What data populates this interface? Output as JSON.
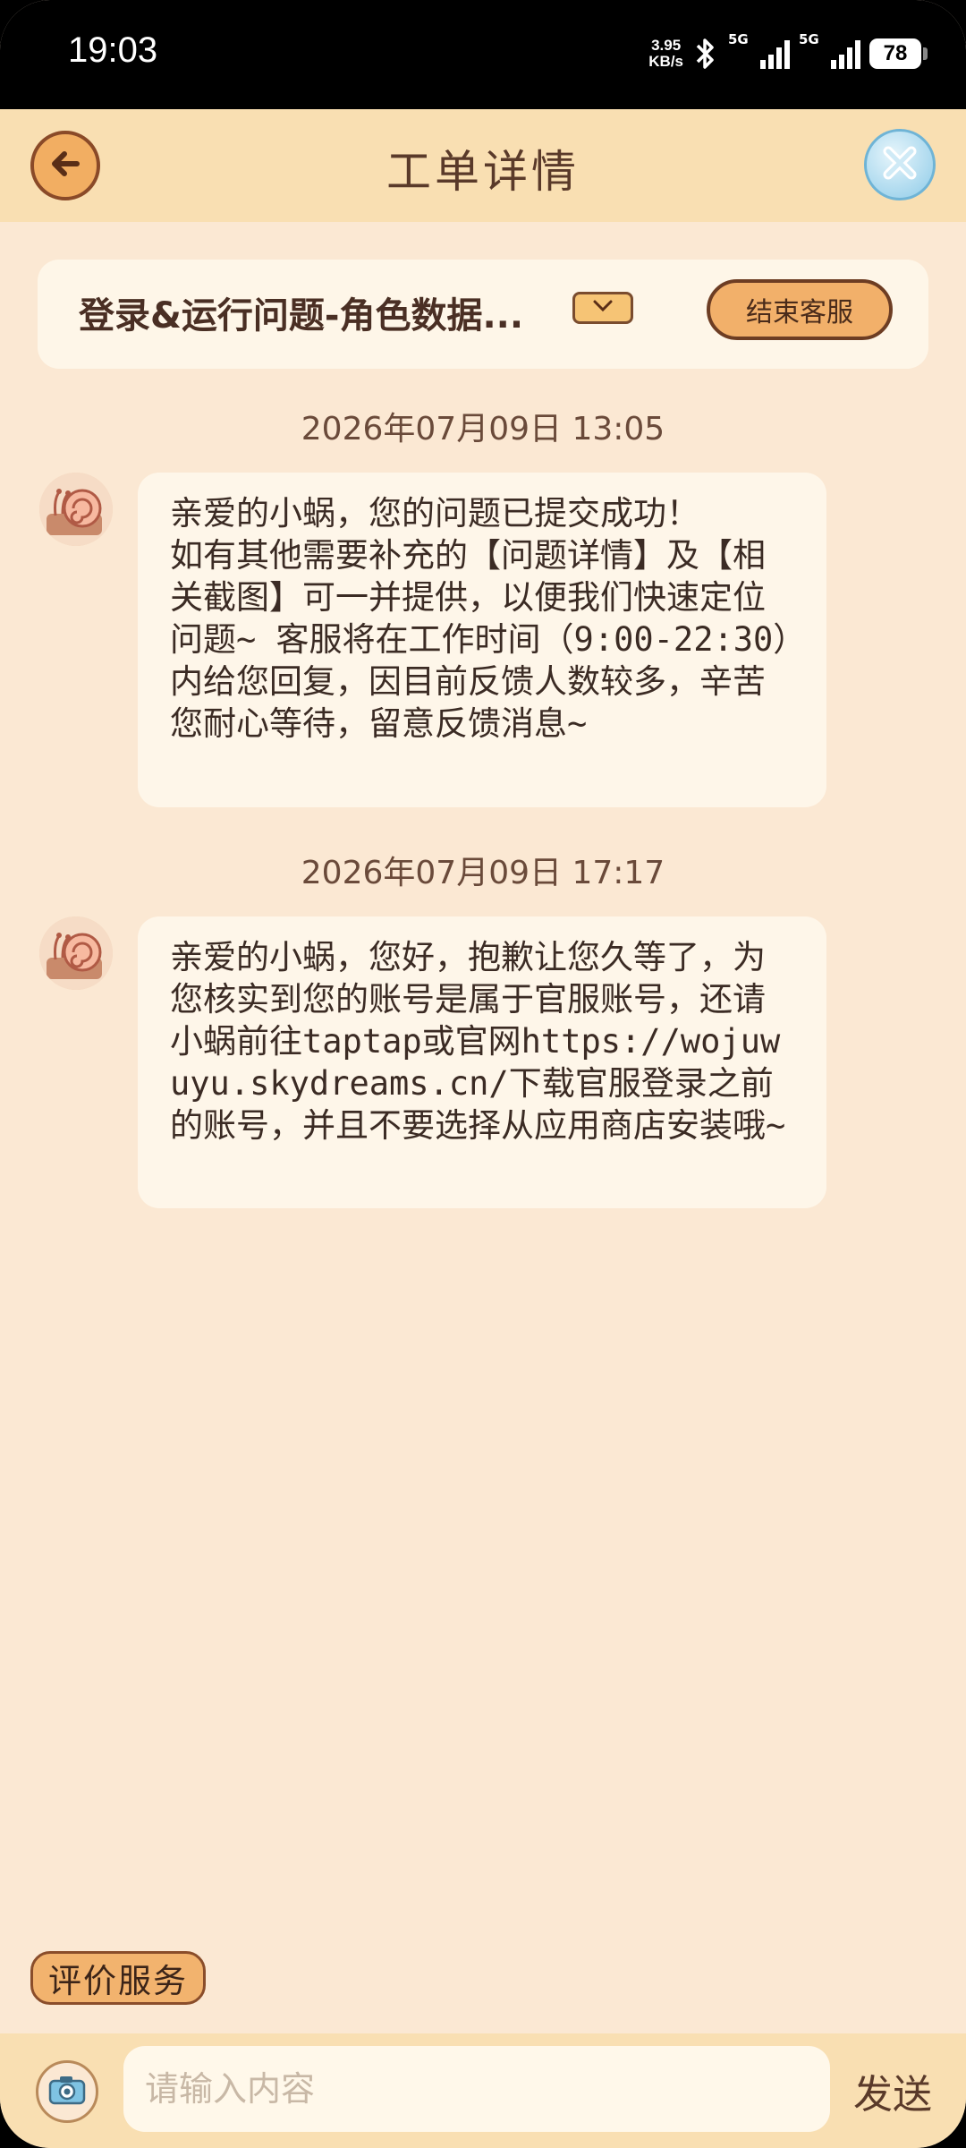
{
  "status_bar": {
    "time": "19:03",
    "net_speed_value": "3.95",
    "net_speed_unit": "KB/s",
    "signal_1_label": "5G",
    "signal_2_label": "5G",
    "battery": "78"
  },
  "header": {
    "title": "工单详情",
    "back_icon": "back-arrow-icon",
    "close_icon": "close-x-icon"
  },
  "ticket": {
    "title": "登录&运行问题-角色数据...",
    "dropdown_icon": "chevron-down-icon",
    "end_service_label": "结束客服"
  },
  "messages": [
    {
      "timestamp": "2026年07月09日 13:05",
      "text": "亲爱的小蜗，您的问题已提交成功！\n如有其他需要补充的【问题详情】及【相关截图】可一并提供，以便我们快速定位问题~ 客服将在工作时间（9:00-22:30）内给您回复，因目前反馈人数较多，辛苦您耐心等待，留意反馈消息~"
    },
    {
      "timestamp": "2026年07月09日 17:17",
      "text": "亲爱的小蜗，您好，抱歉让您久等了，为您核实到您的账号是属于官服账号，还请小蜗前往taptap或官网https://wojuwuyu.skydreams.cn/下载官服登录之前的账号，并且不要选择从应用商店安装哦~"
    }
  ],
  "footer": {
    "rate_label": "评价服务",
    "input_placeholder": "请输入内容",
    "input_value": "",
    "send_label": "发送",
    "camera_icon": "camera-icon"
  },
  "colors": {
    "background": "#fbe8d3",
    "header": "#f9dfb2",
    "bubble": "#fef6e9",
    "accent": "#f2b06a",
    "text": "#3b2b24"
  }
}
